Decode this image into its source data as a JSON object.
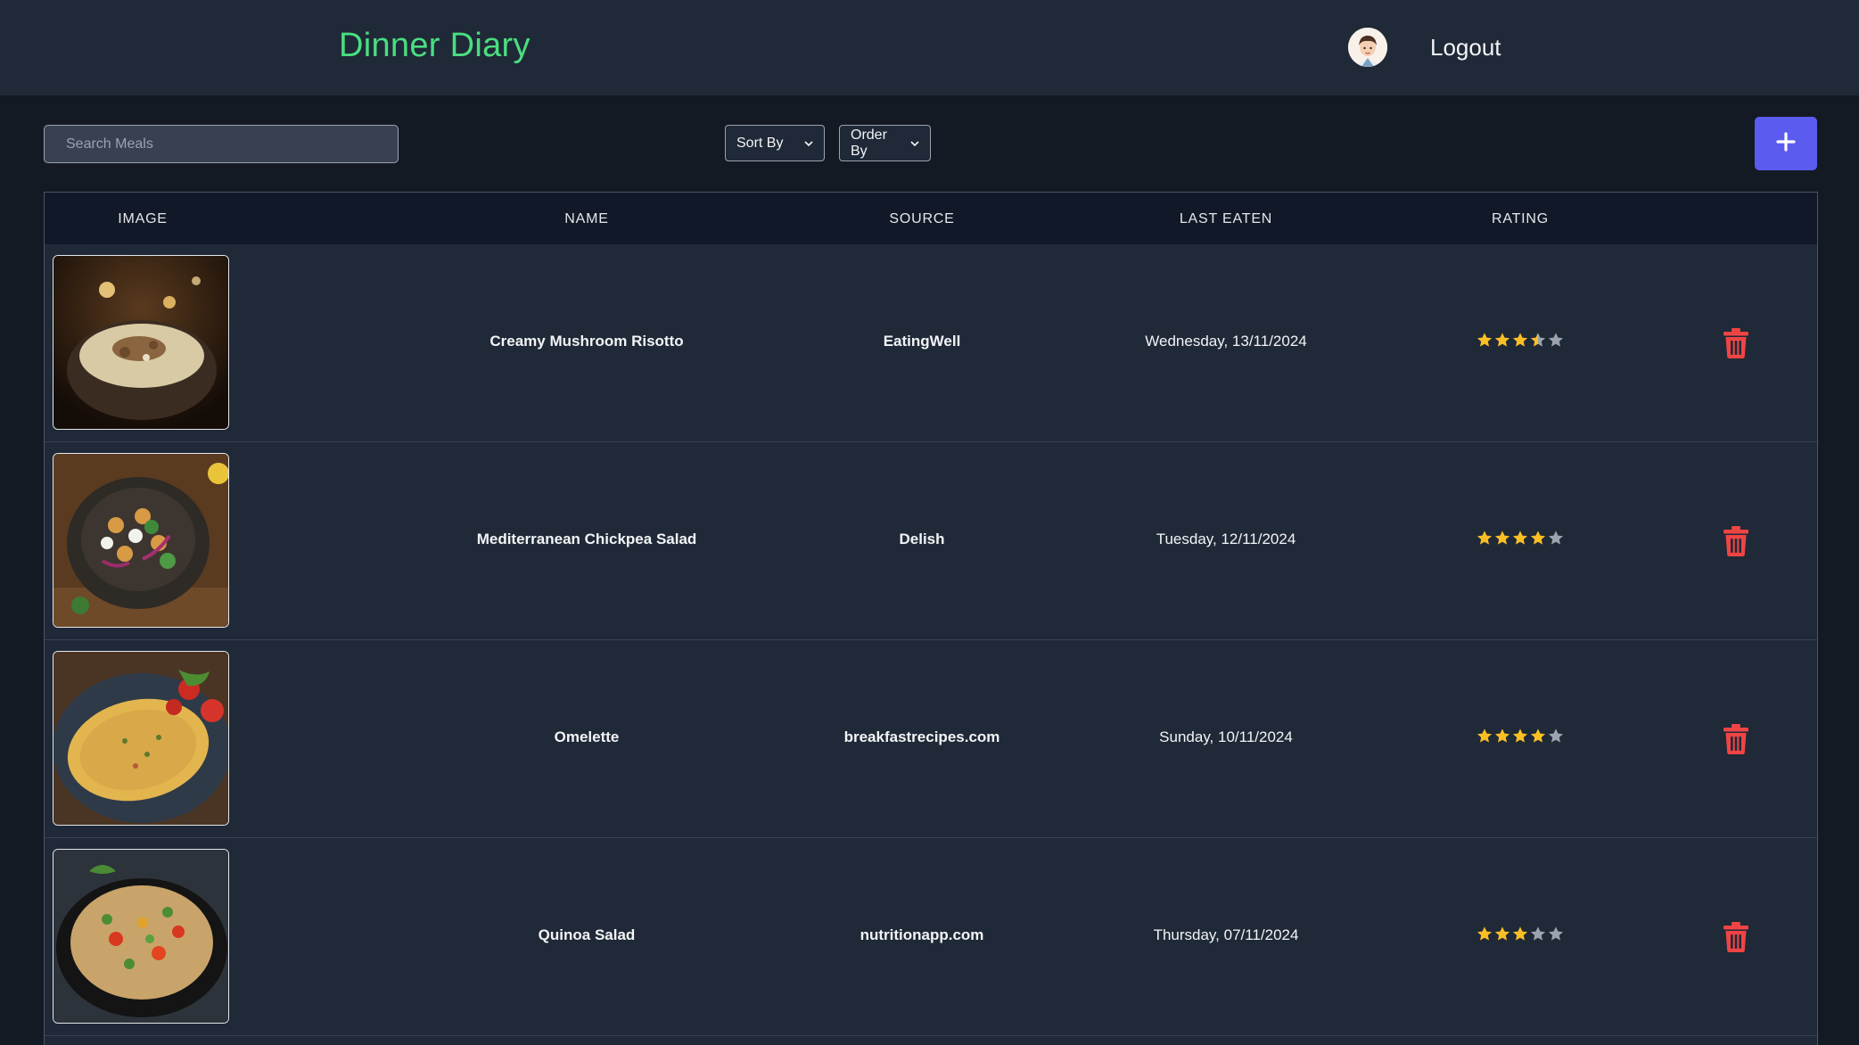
{
  "header": {
    "title": "Dinner Diary",
    "logout_label": "Logout"
  },
  "toolbar": {
    "search_placeholder": "Search Meals",
    "sort_label": "Sort By",
    "order_label": "Order By",
    "add_label": "+"
  },
  "table": {
    "columns": [
      "IMAGE",
      "NAME",
      "SOURCE",
      "LAST EATEN",
      "RATING"
    ],
    "rows": [
      {
        "name": "Creamy Mushroom Risotto",
        "source": "EatingWell",
        "last_eaten": "Wednesday, 13/11/2024",
        "rating": 3.5
      },
      {
        "name": "Mediterranean Chickpea Salad",
        "source": "Delish",
        "last_eaten": "Tuesday, 12/11/2024",
        "rating": 4
      },
      {
        "name": "Omelette",
        "source": "breakfastrecipes.com",
        "last_eaten": "Sunday, 10/11/2024",
        "rating": 4
      },
      {
        "name": "Quinoa Salad",
        "source": "nutritionapp.com",
        "last_eaten": "Thursday, 07/11/2024",
        "rating": 3
      }
    ]
  },
  "colors": {
    "brand": "#4ade80",
    "accent": "#5b5bf0",
    "star_filled": "#fbbf24",
    "star_empty": "#9ca3af",
    "delete": "#ef4444"
  },
  "icons": {
    "add": "plus-icon",
    "delete": "trash-icon",
    "rating": "star-icon",
    "select": "chevron-down-icon"
  }
}
